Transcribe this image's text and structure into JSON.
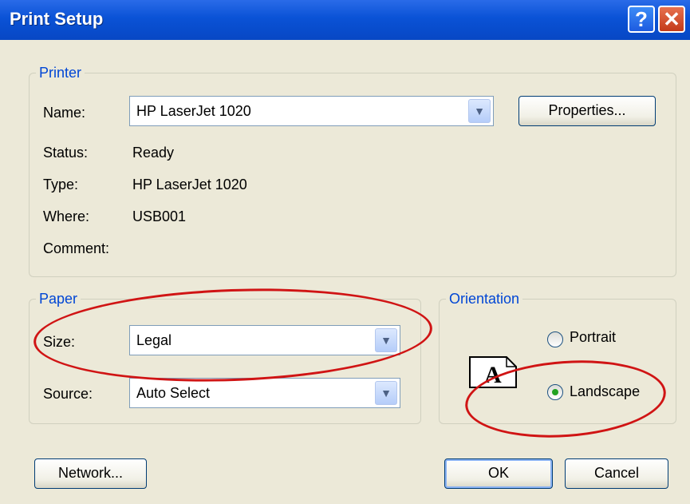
{
  "window": {
    "title": "Print Setup",
    "help_glyph": "?",
    "close_glyph": "✕"
  },
  "printer": {
    "legend": "Printer",
    "name_label": "Name:",
    "name_value": "HP LaserJet 1020",
    "properties_button": "Properties...",
    "status_label": "Status:",
    "status_value": "Ready",
    "type_label": "Type:",
    "type_value": "HP LaserJet 1020",
    "where_label": "Where:",
    "where_value": "USB001",
    "comment_label": "Comment:"
  },
  "paper": {
    "legend": "Paper",
    "size_label": "Size:",
    "size_value": "Legal",
    "source_label": "Source:",
    "source_value": "Auto Select"
  },
  "orientation": {
    "legend": "Orientation",
    "portrait_label": "Portrait",
    "landscape_label": "Landscape",
    "selected": "Landscape",
    "preview_glyph": "A"
  },
  "buttons": {
    "network": "Network...",
    "ok": "OK",
    "cancel": "Cancel"
  },
  "icons": {
    "dropdown": "chevron-down-icon"
  },
  "colors": {
    "titlebar": "#0A52D6",
    "group_legend": "#0046D5",
    "annotation": "#D01414",
    "radio_selected": "#21A121"
  }
}
